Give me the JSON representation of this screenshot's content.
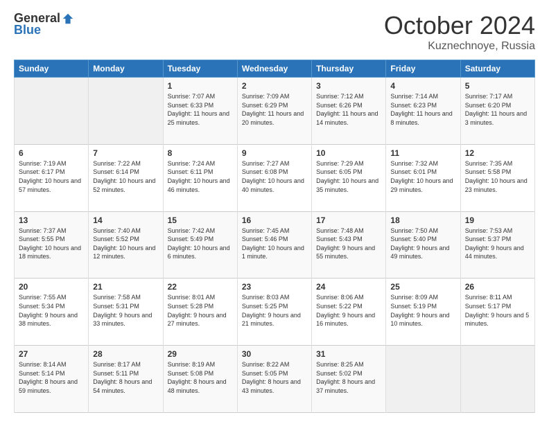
{
  "logo": {
    "general": "General",
    "blue": "Blue"
  },
  "header": {
    "month": "October 2024",
    "location": "Kuznechnoye, Russia"
  },
  "days_of_week": [
    "Sunday",
    "Monday",
    "Tuesday",
    "Wednesday",
    "Thursday",
    "Friday",
    "Saturday"
  ],
  "weeks": [
    [
      {
        "day": "",
        "info": ""
      },
      {
        "day": "",
        "info": ""
      },
      {
        "day": "1",
        "info": "Sunrise: 7:07 AM\nSunset: 6:33 PM\nDaylight: 11 hours and 25 minutes."
      },
      {
        "day": "2",
        "info": "Sunrise: 7:09 AM\nSunset: 6:29 PM\nDaylight: 11 hours and 20 minutes."
      },
      {
        "day": "3",
        "info": "Sunrise: 7:12 AM\nSunset: 6:26 PM\nDaylight: 11 hours and 14 minutes."
      },
      {
        "day": "4",
        "info": "Sunrise: 7:14 AM\nSunset: 6:23 PM\nDaylight: 11 hours and 8 minutes."
      },
      {
        "day": "5",
        "info": "Sunrise: 7:17 AM\nSunset: 6:20 PM\nDaylight: 11 hours and 3 minutes."
      }
    ],
    [
      {
        "day": "6",
        "info": "Sunrise: 7:19 AM\nSunset: 6:17 PM\nDaylight: 10 hours and 57 minutes."
      },
      {
        "day": "7",
        "info": "Sunrise: 7:22 AM\nSunset: 6:14 PM\nDaylight: 10 hours and 52 minutes."
      },
      {
        "day": "8",
        "info": "Sunrise: 7:24 AM\nSunset: 6:11 PM\nDaylight: 10 hours and 46 minutes."
      },
      {
        "day": "9",
        "info": "Sunrise: 7:27 AM\nSunset: 6:08 PM\nDaylight: 10 hours and 40 minutes."
      },
      {
        "day": "10",
        "info": "Sunrise: 7:29 AM\nSunset: 6:05 PM\nDaylight: 10 hours and 35 minutes."
      },
      {
        "day": "11",
        "info": "Sunrise: 7:32 AM\nSunset: 6:01 PM\nDaylight: 10 hours and 29 minutes."
      },
      {
        "day": "12",
        "info": "Sunrise: 7:35 AM\nSunset: 5:58 PM\nDaylight: 10 hours and 23 minutes."
      }
    ],
    [
      {
        "day": "13",
        "info": "Sunrise: 7:37 AM\nSunset: 5:55 PM\nDaylight: 10 hours and 18 minutes."
      },
      {
        "day": "14",
        "info": "Sunrise: 7:40 AM\nSunset: 5:52 PM\nDaylight: 10 hours and 12 minutes."
      },
      {
        "day": "15",
        "info": "Sunrise: 7:42 AM\nSunset: 5:49 PM\nDaylight: 10 hours and 6 minutes."
      },
      {
        "day": "16",
        "info": "Sunrise: 7:45 AM\nSunset: 5:46 PM\nDaylight: 10 hours and 1 minute."
      },
      {
        "day": "17",
        "info": "Sunrise: 7:48 AM\nSunset: 5:43 PM\nDaylight: 9 hours and 55 minutes."
      },
      {
        "day": "18",
        "info": "Sunrise: 7:50 AM\nSunset: 5:40 PM\nDaylight: 9 hours and 49 minutes."
      },
      {
        "day": "19",
        "info": "Sunrise: 7:53 AM\nSunset: 5:37 PM\nDaylight: 9 hours and 44 minutes."
      }
    ],
    [
      {
        "day": "20",
        "info": "Sunrise: 7:55 AM\nSunset: 5:34 PM\nDaylight: 9 hours and 38 minutes."
      },
      {
        "day": "21",
        "info": "Sunrise: 7:58 AM\nSunset: 5:31 PM\nDaylight: 9 hours and 33 minutes."
      },
      {
        "day": "22",
        "info": "Sunrise: 8:01 AM\nSunset: 5:28 PM\nDaylight: 9 hours and 27 minutes."
      },
      {
        "day": "23",
        "info": "Sunrise: 8:03 AM\nSunset: 5:25 PM\nDaylight: 9 hours and 21 minutes."
      },
      {
        "day": "24",
        "info": "Sunrise: 8:06 AM\nSunset: 5:22 PM\nDaylight: 9 hours and 16 minutes."
      },
      {
        "day": "25",
        "info": "Sunrise: 8:09 AM\nSunset: 5:19 PM\nDaylight: 9 hours and 10 minutes."
      },
      {
        "day": "26",
        "info": "Sunrise: 8:11 AM\nSunset: 5:17 PM\nDaylight: 9 hours and 5 minutes."
      }
    ],
    [
      {
        "day": "27",
        "info": "Sunrise: 8:14 AM\nSunset: 5:14 PM\nDaylight: 8 hours and 59 minutes."
      },
      {
        "day": "28",
        "info": "Sunrise: 8:17 AM\nSunset: 5:11 PM\nDaylight: 8 hours and 54 minutes."
      },
      {
        "day": "29",
        "info": "Sunrise: 8:19 AM\nSunset: 5:08 PM\nDaylight: 8 hours and 48 minutes."
      },
      {
        "day": "30",
        "info": "Sunrise: 8:22 AM\nSunset: 5:05 PM\nDaylight: 8 hours and 43 minutes."
      },
      {
        "day": "31",
        "info": "Sunrise: 8:25 AM\nSunset: 5:02 PM\nDaylight: 8 hours and 37 minutes."
      },
      {
        "day": "",
        "info": ""
      },
      {
        "day": "",
        "info": ""
      }
    ]
  ]
}
